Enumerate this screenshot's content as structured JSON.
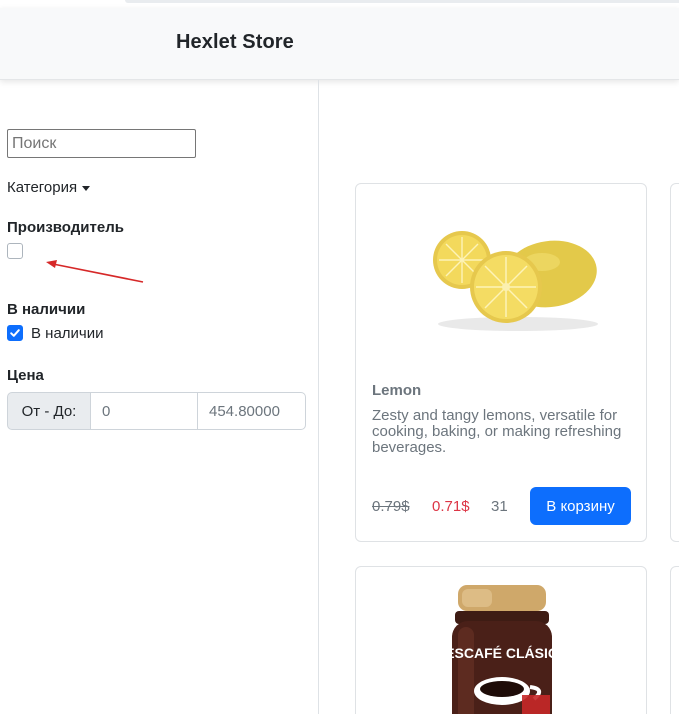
{
  "navbar": {
    "brand": "Hexlet Store"
  },
  "sidebar": {
    "search_placeholder": "Поиск",
    "category_label": "Категория",
    "manufacturer_heading": "Производитель",
    "stock_heading": "В наличии",
    "stock_checkbox_label": "В наличии",
    "price_heading": "Цена",
    "price_addon": "От - До:",
    "price_from": "0",
    "price_to": "454.80000"
  },
  "products": [
    {
      "title": "Lemon",
      "description": "Zesty and tangy lemons, versatile for cooking, baking, or making refreshing beverages.",
      "old_price": "0.79$",
      "new_price": "0.71$",
      "quantity": "31",
      "button_label": "В корзину"
    },
    {
      "image_text": "NESCAFÉ CLÁSICO"
    }
  ],
  "colors": {
    "primary": "#0d6efd",
    "danger": "#dc3545",
    "muted": "#6c757d",
    "navbar_bg": "#f8f9fa",
    "annotation_arrow": "#d62828"
  }
}
